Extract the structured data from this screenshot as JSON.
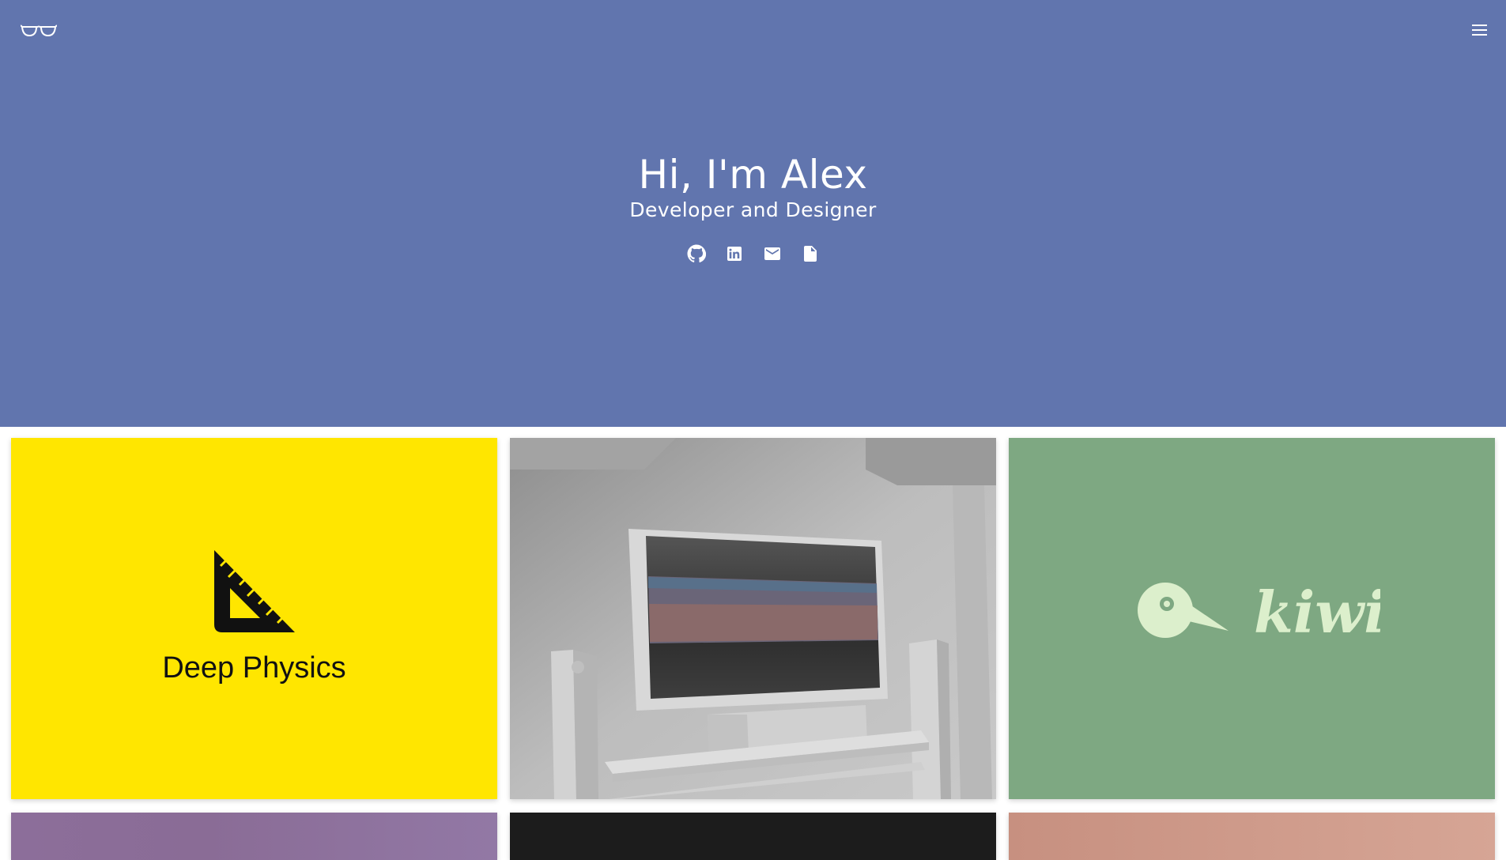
{
  "header": {
    "logo_icon": "glasses-icon",
    "menu_icon": "hamburger-menu-icon",
    "background": "#6175ae"
  },
  "hero": {
    "title": "Hi, I'm Alex",
    "subtitle": "Developer and Designer",
    "social_links": [
      {
        "icon": "github-icon"
      },
      {
        "icon": "linkedin-icon"
      },
      {
        "icon": "email-icon"
      },
      {
        "icon": "document-icon"
      }
    ]
  },
  "projects": {
    "cards": [
      {
        "title": "Deep Physics",
        "icon": "set-square-ruler-icon",
        "background": "#ffe600"
      },
      {
        "image": "3d-room-tv-render",
        "background": "#bdbdbd"
      },
      {
        "logo_text": "kiwi",
        "icon": "kiwi-bird-icon",
        "background": "#7ea882"
      },
      {
        "background": "#8c6e9a"
      },
      {
        "background": "#1c1c1c"
      },
      {
        "background": "#cf9c8c"
      }
    ]
  }
}
